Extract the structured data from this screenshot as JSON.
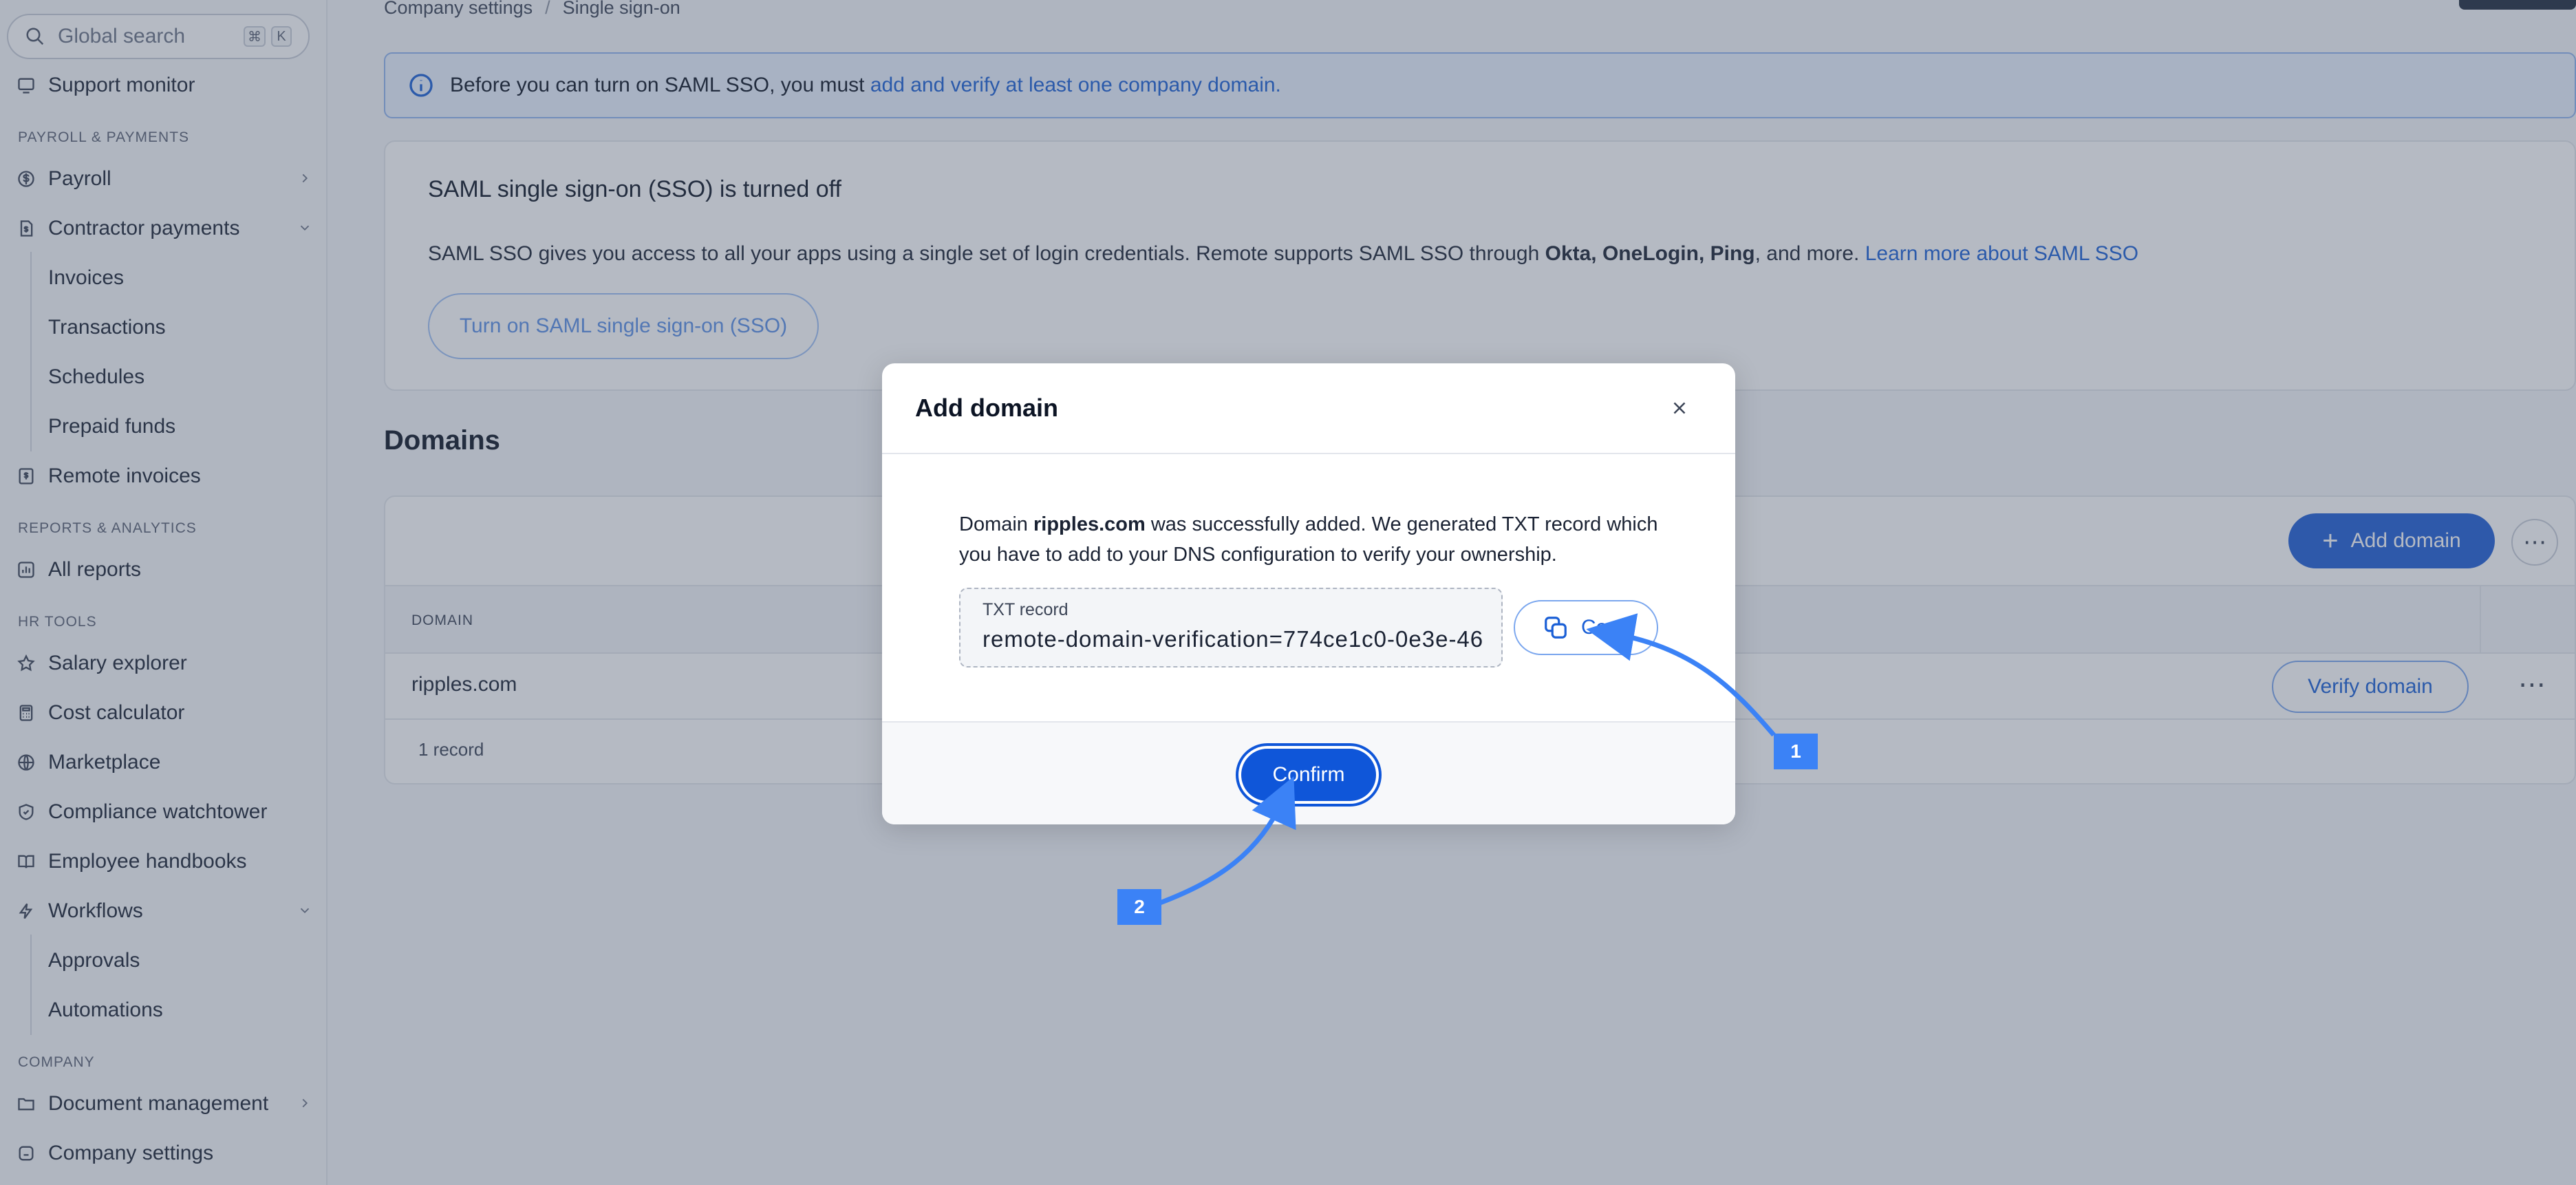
{
  "sidebar": {
    "search_placeholder": "Global search",
    "search_kbd": [
      "⌘",
      "K"
    ],
    "items": {
      "support_monitor": "Support monitor",
      "payroll_section": "PAYROLL & PAYMENTS",
      "payroll": "Payroll",
      "contractor_payments": "Contractor payments",
      "invoices": "Invoices",
      "transactions": "Transactions",
      "schedules": "Schedules",
      "prepaid_funds": "Prepaid funds",
      "remote_invoices": "Remote invoices",
      "reports_section": "REPORTS & ANALYTICS",
      "all_reports": "All reports",
      "hr_section": "HR TOOLS",
      "salary_explorer": "Salary explorer",
      "cost_calculator": "Cost calculator",
      "marketplace": "Marketplace",
      "compliance_watchtower": "Compliance watchtower",
      "employee_handbooks": "Employee handbooks",
      "workflows": "Workflows",
      "approvals": "Approvals",
      "automations": "Automations",
      "company_section": "COMPANY",
      "document_management": "Document management",
      "company_settings": "Company settings"
    }
  },
  "breadcrumb": {
    "parent": "Company settings",
    "separator": "/",
    "current": "Single sign-on"
  },
  "banner": {
    "text": "Before you can turn on SAML SSO, you must ",
    "link": "add and verify at least one company domain."
  },
  "sso": {
    "title": "SAML single sign-on (SSO) is turned off",
    "desc_prefix": "SAML SSO gives you access to all your apps using a single set of login credentials. Remote supports SAML SSO through ",
    "providers": "Okta, OneLogin, Ping",
    "desc_suffix": ", and more. ",
    "learn_more": "Learn more about SAML SSO",
    "button": "Turn on SAML single sign-on (SSO)"
  },
  "domains": {
    "title": "Domains",
    "add_button": "Add domain",
    "more": "⋯",
    "column_domain": "DOMAIN",
    "rows": [
      {
        "domain": "ripples.com",
        "action": "Verify domain"
      }
    ],
    "footer": "1 record"
  },
  "modal": {
    "title": "Add domain",
    "text_prefix": "Domain ",
    "domain": "ripples.com",
    "text_suffix": " was successfully added. We generated TXT record which you have to add to your DNS configuration to verify your ownership.",
    "field_label": "TXT record",
    "field_value": "remote-domain-verification=774ce1c0-0e3e-46",
    "copy_button": "Copy",
    "confirm_button": "Confirm"
  },
  "annotations": {
    "badge_1": "1",
    "badge_2": "2",
    "color": "#3b82f6"
  }
}
